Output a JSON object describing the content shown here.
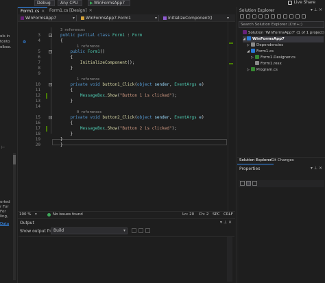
{
  "toolbar": {
    "config": "Debug",
    "platform": "Any CPU",
    "run_target": "WinFormsApp7",
    "live_share": "Live Share"
  },
  "left_strip": {
    "top_lines": [
      "ols in",
      "tonto",
      "olbox."
    ],
    "bottom_lines": [
      "orted",
      "r For",
      "For",
      "ling,"
    ],
    "link": "Data"
  },
  "editor": {
    "tabs": [
      {
        "label": "Form1.cs",
        "close": "✕"
      },
      {
        "label": "Form1.cs [Design]",
        "close": "✕"
      }
    ],
    "nav": {
      "project": "WinFormsApp7",
      "class": "WinFormsApp7.Form1",
      "member": "InitializeComponent()"
    },
    "lines": [
      {
        "n": "",
        "lens": "3 references"
      },
      {
        "n": "3",
        "code": [
          [
            "kw",
            "public partial class "
          ],
          [
            "ty",
            "Form1"
          ],
          [
            "pl",
            " : "
          ],
          [
            "ty",
            "Form"
          ]
        ]
      },
      {
        "n": "4",
        "code": [
          [
            "pl",
            "{"
          ]
        ]
      },
      {
        "n": "",
        "lens": "1 reference"
      },
      {
        "n": "5",
        "code": [
          [
            "kw",
            "    public "
          ],
          [
            "ty",
            "Form1"
          ],
          [
            "pl",
            "()"
          ]
        ]
      },
      {
        "n": "6",
        "code": [
          [
            "pl",
            "    {"
          ]
        ]
      },
      {
        "n": "7",
        "code": [
          [
            "fn",
            "        InitializeComponent"
          ],
          [
            "pl",
            "();"
          ]
        ]
      },
      {
        "n": "8",
        "code": [
          [
            "pl",
            "    }"
          ]
        ]
      },
      {
        "n": "9",
        "code": [
          [
            "pl",
            ""
          ]
        ]
      },
      {
        "n": "",
        "lens": "1 reference"
      },
      {
        "n": "10",
        "code": [
          [
            "kw",
            "    private void "
          ],
          [
            "fn",
            "button1_Click"
          ],
          [
            "pl",
            "("
          ],
          [
            "kw",
            "object "
          ],
          [
            "pm",
            "sender"
          ],
          [
            "pl",
            ", "
          ],
          [
            "ty",
            "EventArgs "
          ],
          [
            "pm",
            "e"
          ],
          [
            "pl",
            ")"
          ]
        ]
      },
      {
        "n": "11",
        "code": [
          [
            "pl",
            "    {"
          ]
        ]
      },
      {
        "n": "12",
        "code": [
          [
            "ty",
            "        MessageBox"
          ],
          [
            "pl",
            "."
          ],
          [
            "fn",
            "Show"
          ],
          [
            "pl",
            "("
          ],
          [
            "st",
            "\"Button 1 is clicked\""
          ],
          [
            "pl",
            ");"
          ]
        ]
      },
      {
        "n": "13",
        "code": [
          [
            "pl",
            "    }"
          ]
        ]
      },
      {
        "n": "14",
        "code": [
          [
            "pl",
            ""
          ]
        ]
      },
      {
        "n": "",
        "lens": "0 references"
      },
      {
        "n": "15",
        "code": [
          [
            "kw",
            "    private void "
          ],
          [
            "fn",
            "button2_Click"
          ],
          [
            "pl",
            "("
          ],
          [
            "kw",
            "object "
          ],
          [
            "pm",
            "sender"
          ],
          [
            "pl",
            ", "
          ],
          [
            "ty",
            "EventArgs "
          ],
          [
            "pm",
            "e"
          ],
          [
            "pl",
            ")"
          ]
        ]
      },
      {
        "n": "16",
        "code": [
          [
            "pl",
            "    {"
          ]
        ]
      },
      {
        "n": "17",
        "code": [
          [
            "ty",
            "        MessageBox"
          ],
          [
            "pl",
            "."
          ],
          [
            "fn",
            "Show"
          ],
          [
            "pl",
            "("
          ],
          [
            "st",
            "\"Button 2 is clicked\""
          ],
          [
            "pl",
            ");"
          ]
        ]
      },
      {
        "n": "18",
        "code": [
          [
            "pl",
            "    }"
          ]
        ]
      },
      {
        "n": "19",
        "code": [
          [
            "pl",
            "}"
          ]
        ]
      },
      {
        "n": "20",
        "code": [
          [
            "pl",
            "}"
          ]
        ]
      }
    ],
    "status": {
      "zoom": "100 %",
      "issues": "No issues found",
      "ln": "Ln: 20",
      "ch": "Ch: 2",
      "spc": "SPC",
      "crlf": "CRLF"
    }
  },
  "output": {
    "title": "Output",
    "show_from_label": "Show output from:",
    "source": "Build"
  },
  "solution_explorer": {
    "title": "Solution Explorer",
    "search_placeholder": "Search Solution Explorer (Ctrl+;)",
    "tree": [
      {
        "label": "Solution 'WinFormsApp7' (1 of 1 project)",
        "icon": "solution-icon",
        "depth": 0,
        "arrow": ""
      },
      {
        "label": "WinFormsApp7",
        "icon": "project-icon",
        "depth": 1,
        "arrow": "◢",
        "selected": true
      },
      {
        "label": "Dependencies",
        "icon": "dependencies-icon",
        "depth": 2,
        "arrow": "▷"
      },
      {
        "label": "Form1.cs",
        "icon": "form-icon",
        "depth": 2,
        "arrow": "◢"
      },
      {
        "label": "Form1.Designer.cs",
        "icon": "csharp-file-icon",
        "depth": 3,
        "arrow": "▷"
      },
      {
        "label": "Form1.resx",
        "icon": "resx-file-icon",
        "depth": 3,
        "arrow": ""
      },
      {
        "label": "Program.cs",
        "icon": "csharp-file-icon",
        "depth": 2,
        "arrow": "▷"
      }
    ],
    "tabs": [
      "Solution Explorer",
      "Git Changes"
    ]
  },
  "properties": {
    "title": "Properties"
  },
  "colors": {
    "accent": "#3794ff",
    "change_bar": "#487e02",
    "keyword": "#569cd6",
    "type": "#4ec9b0",
    "method": "#dcdcaa",
    "string": "#d69d85"
  }
}
